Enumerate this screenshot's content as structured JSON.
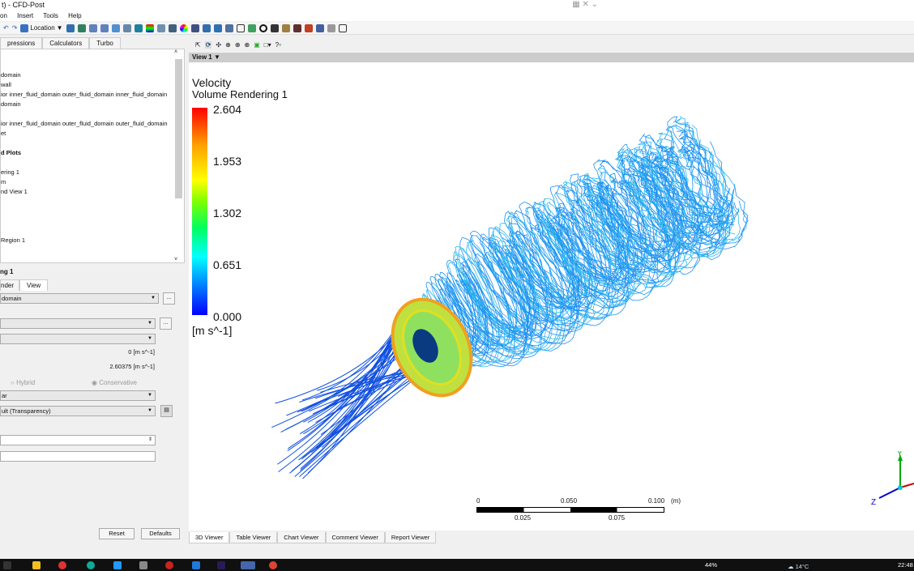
{
  "window": {
    "title": "t) - CFD-Post"
  },
  "menu": [
    "on",
    "Insert",
    "Tools",
    "Help"
  ],
  "toolbar": {
    "location_label": "Location"
  },
  "left_tabs": [
    "pressions",
    "Calculators",
    "Turbo"
  ],
  "tree": [
    "domain",
    "wall",
    "ior inner_fluid_domain outer_fluid_domain inner_fluid_domain",
    "domain",
    "ior inner_fluid_domain outer_fluid_domain outer_fluid_domain",
    "et",
    "d Plots",
    "ering 1",
    "m",
    "nd View 1",
    "Region 1"
  ],
  "details": {
    "title": "ng 1",
    "tabs": [
      "nder",
      "View"
    ],
    "domain_value": "domain",
    "dots_label": "...",
    "min_value": "0 [m s^-1]",
    "max_value": "2.60375 [m s^-1]",
    "radio_hybrid": "Hybrid",
    "radio_conservative": "Conservative",
    "scale_value": "ar",
    "transparency_value": "ult (Transparency)",
    "reset_label": "Reset",
    "defaults_label": "Defaults"
  },
  "view": {
    "name": "View 1"
  },
  "legend": {
    "title": "Velocity",
    "subtitle": "Volume Rendering 1",
    "ticks": [
      "2.604",
      "1.953",
      "1.302",
      "0.651",
      "0.000"
    ],
    "units": "[m s^-1]"
  },
  "scale_bar": {
    "top": [
      "0",
      "0.050",
      "0.100",
      "(m)"
    ],
    "bottom": [
      "0.025",
      "0.075"
    ]
  },
  "axes": {
    "y": "Y",
    "z": "Z"
  },
  "bottom_tabs": [
    "3D Viewer",
    "Table Viewer",
    "Chart Viewer",
    "Comment Viewer",
    "Report Viewer"
  ],
  "taskbar": {
    "battery": "44%",
    "weather": "14°C",
    "time": "22:48"
  }
}
